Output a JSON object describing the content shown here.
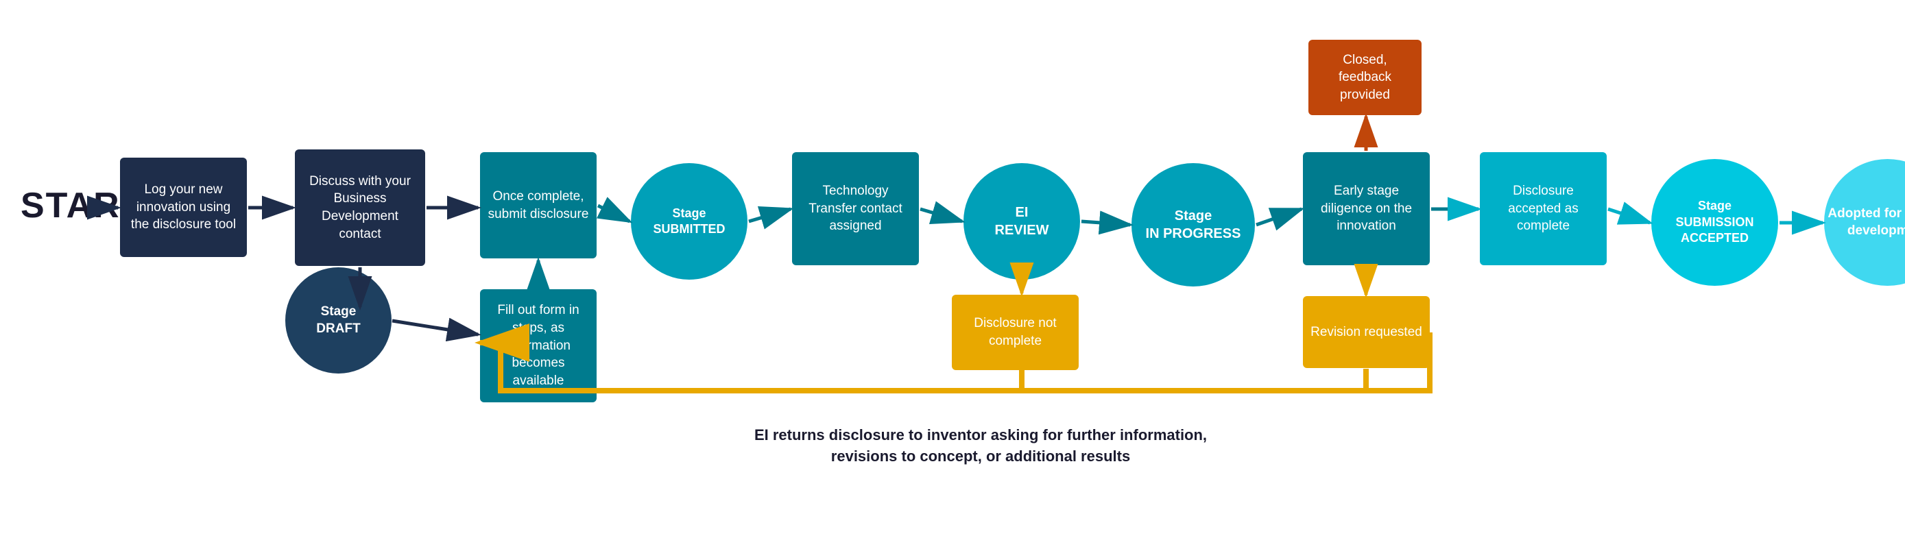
{
  "diagram": {
    "start_label": "START",
    "boxes": {
      "log_innovation": "Log your new innovation using the disclosure tool",
      "discuss_bd": "Discuss with your Business Development contact",
      "once_complete": "Once complete, submit disclosure",
      "fill_out": "Fill out form in steps, as information becomes available",
      "tech_transfer": "Technology Transfer contact assigned",
      "early_stage": "Early stage diligence on the innovation",
      "disclosure_accepted": "Disclosure accepted as complete",
      "adopted": "Adopted for further development",
      "closed_feedback": "Closed, feedback provided",
      "revision_requested": "Revision requested",
      "disclosure_not_complete": "Disclosure not complete"
    },
    "circles": {
      "stage_draft": "Stage\nDRAFT",
      "stage_submitted": "Stage\nSUBMITTED",
      "ei_review": "EI\nREVIEW",
      "stage_in_progress": "Stage\nIN PROGRESS",
      "stage_submission_accepted": "Stage\nSUBMISSION\nACCEPTED"
    },
    "bottom_text_line1": "EI returns disclosure to inventor asking for further information,",
    "bottom_text_line2": "revisions to concept, or additional results"
  }
}
